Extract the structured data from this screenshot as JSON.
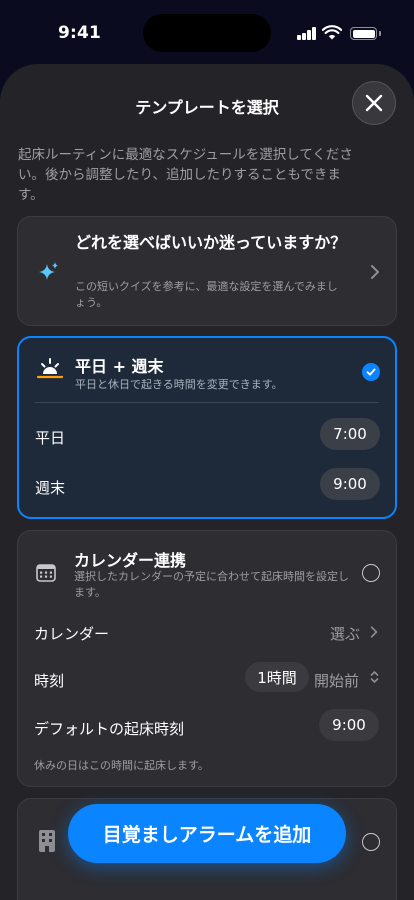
{
  "status_bar": {
    "time": "9:41"
  },
  "sheet": {
    "title": "テンプレートを選択",
    "intro": "起床ルーティンに最適なスケジュールを選択してください。後から調整したり、追加したりすることもできます。"
  },
  "quiz_card": {
    "title": "どれを選べばいいか迷っていますか？",
    "description": "この短いクイズを参考に、最適な設定を選んでみましょう。"
  },
  "weekday_weekend_card": {
    "title": "平日 + 週末",
    "description": "平日と休日で起きる時間を変更できます。",
    "selected": true,
    "rows": [
      {
        "label": "平日",
        "value": "7:00"
      },
      {
        "label": "週末",
        "value": "9:00"
      }
    ]
  },
  "calendar_card": {
    "title": "カレンダー連携",
    "description": "選択したカレンダーの予定に合わせて起床時間を設定します。",
    "selected": false,
    "calendar_row": {
      "label": "カレンダー",
      "value": "選ぶ"
    },
    "time_row": {
      "label": "時刻",
      "offset": "1時間",
      "relation": "開始前"
    },
    "default_row": {
      "label": "デフォルトの起床時刻",
      "value": "9:00"
    },
    "note": "休みの日はこの時間に起床します。"
  },
  "add_button": {
    "label": "目覚ましアラームを追加"
  },
  "colors": {
    "accent": "#0a84ff",
    "sheet_background": "#242428",
    "card_background": "#2d2d32"
  },
  "icons": [
    "signal-icon",
    "wifi-icon",
    "battery-icon",
    "close-icon",
    "sparkle-icon",
    "chevron-right-icon",
    "sunrise-icon",
    "checkmark-icon",
    "calendar-icon",
    "chevron-updown-icon",
    "building-icon"
  ]
}
